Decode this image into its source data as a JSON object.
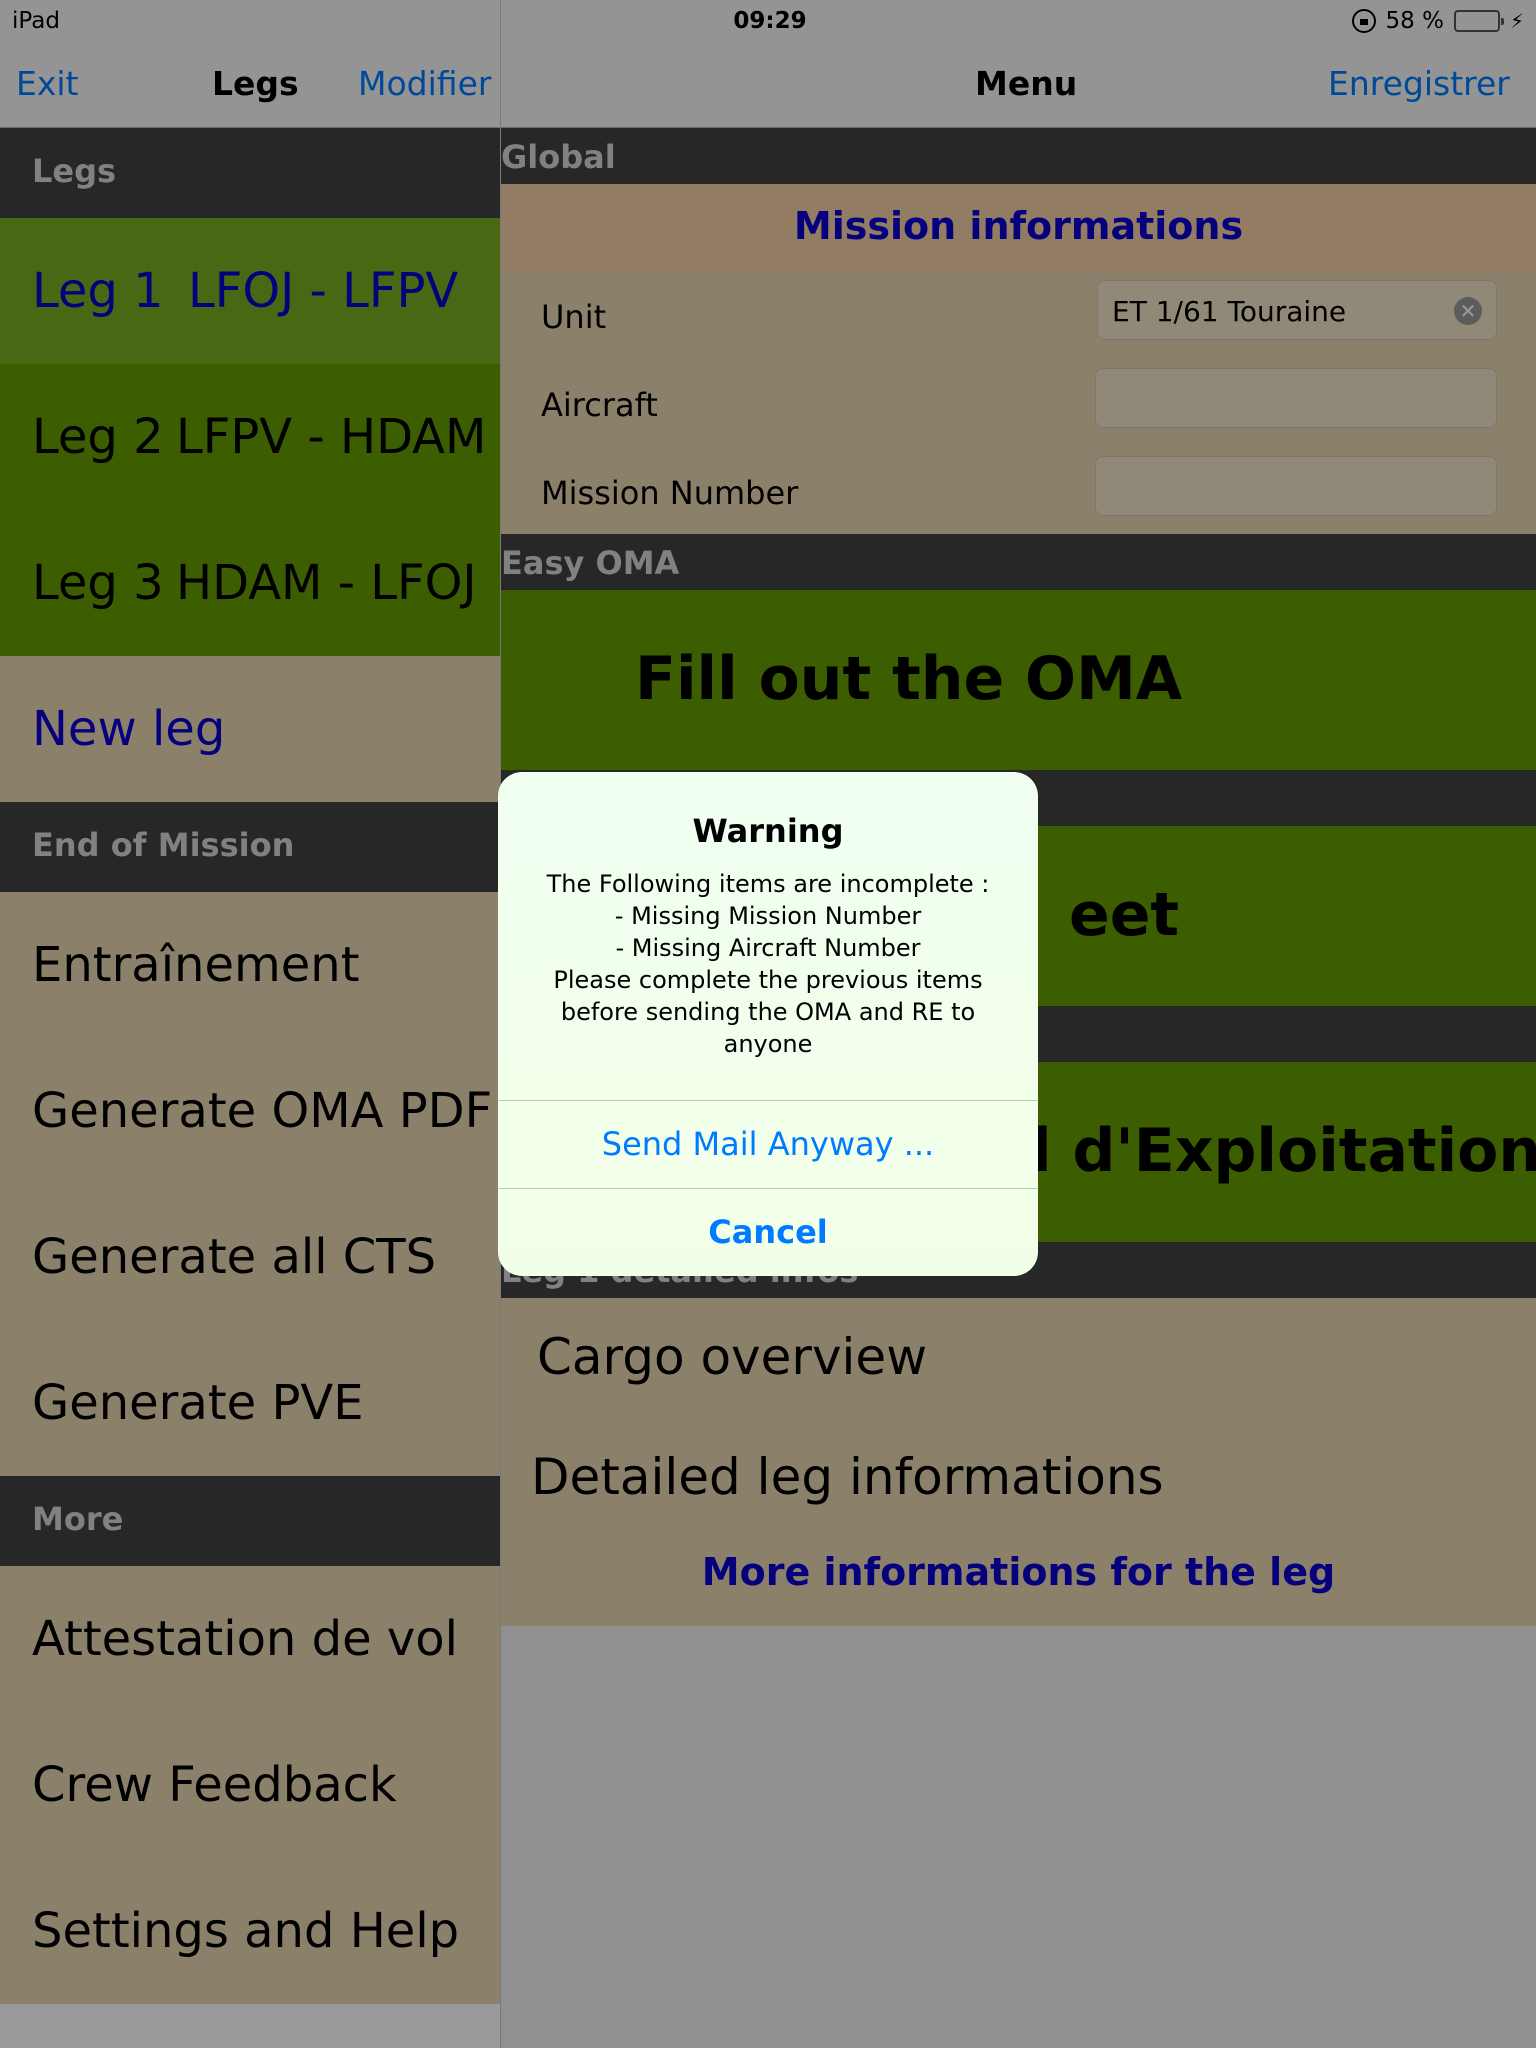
{
  "status_bar": {
    "device": "iPad",
    "time": "09:29",
    "battery": "58 %",
    "battery_level": 0.58
  },
  "left_nav": {
    "exit": "Exit",
    "title": "Legs",
    "edit": "Modifier"
  },
  "right_nav": {
    "title": "Menu",
    "save": "Enregistrer"
  },
  "master": {
    "legs_header": "Legs",
    "legs": [
      {
        "number": "Leg 1",
        "route": "LFOJ - LFPV"
      },
      {
        "number": "Leg 2",
        "route": "LFPV - HDAM"
      },
      {
        "number": "Leg 3",
        "route": "HDAM - LFOJ"
      }
    ],
    "new_leg": "New leg",
    "end_header": "End of Mission",
    "end_items": [
      "Entraînement",
      "Generate OMA PDF",
      "Generate all CTS",
      "Generate PVE"
    ],
    "more_header": "More",
    "more_items": [
      "Attestation de vol",
      "Crew Feedback",
      "Settings and Help"
    ]
  },
  "detail": {
    "global_header": "Global",
    "mission_title": "Mission informations",
    "unit_label": "Unit",
    "unit_value": "ET 1/61 Touraine",
    "aircraft_label": "Aircraft",
    "aircraft_value": "",
    "mission_number_label": "Mission Number",
    "mission_number_value": "",
    "easy_oma_header": "Easy OMA",
    "fill_oma": "Fill out the OMA",
    "sheet_partial": "eet",
    "exploitation_partial": "l d'Exploitation",
    "leg_detail_header": "Leg 1 detailed infos",
    "cargo": "Cargo overview",
    "detailed_leg": "Detailed leg informations",
    "more_info": "More informations for the leg"
  },
  "alert": {
    "title": "Warning",
    "message": "The Following items are incomplete :\n- Missing Mission Number\n- Missing Aircraft Number\nPlease complete the previous items\nbefore sending the OMA and RE to\nanyone",
    "send_button": "Send Mail Anyway ...",
    "cancel_button": "Cancel"
  }
}
